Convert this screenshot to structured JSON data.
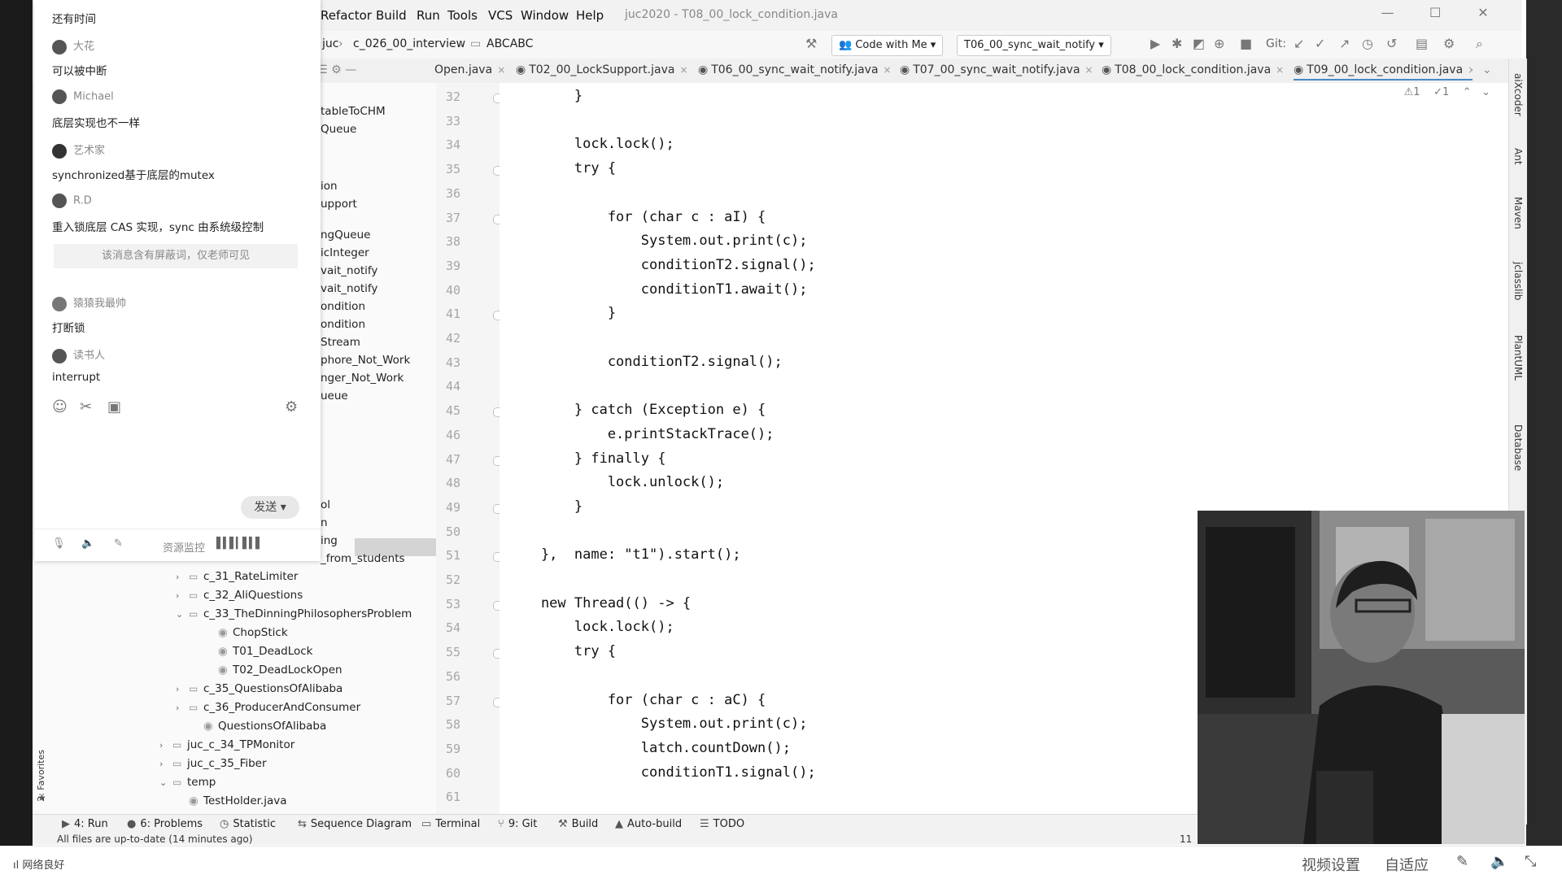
{
  "ide": {
    "menu": [
      "Refactor",
      "Build",
      "Run",
      "Tools",
      "VCS",
      "Window",
      "Help"
    ],
    "title": "juc2020 - T08_00_lock_condition.java",
    "breadcrumb": [
      "juc",
      "c_026_00_interview",
      "ABCABC"
    ],
    "toolbar": {
      "code_with_me": "Code with Me",
      "run_config": "T06_00_sync_wait_notify",
      "git_label": "Git:"
    },
    "tabs": [
      "Open.java",
      "T02_00_LockSupport.java",
      "T06_00_sync_wait_notify.java",
      "T07_00_sync_wait_notify.java",
      "T08_00_lock_condition.java",
      "T09_00_lock_condition.java"
    ],
    "inspection": {
      "warnings": "1",
      "weak_warnings": "1"
    }
  },
  "project_tree": {
    "partial_items": [
      "tableToCHM",
      "Queue",
      "ion",
      "upport",
      "ngQueue",
      "icInteger",
      "vait_notify",
      "vait_notify",
      "ondition",
      "ondition",
      "Stream",
      "phore_Not_Work",
      "nger_Not_Work",
      "ueue",
      "ol",
      "n",
      "ing",
      "_from_students"
    ],
    "items": [
      {
        "label": "c_31_RateLimiter",
        "type": "folder",
        "expanded": false
      },
      {
        "label": "c_32_AliQuestions",
        "type": "folder",
        "expanded": false
      },
      {
        "label": "c_33_TheDinningPhilosophersProblem",
        "type": "folder",
        "expanded": true
      },
      {
        "label": "ChopStick",
        "type": "class"
      },
      {
        "label": "T01_DeadLock",
        "type": "class"
      },
      {
        "label": "T02_DeadLockOpen",
        "type": "class"
      },
      {
        "label": "c_35_QuestionsOfAlibaba",
        "type": "folder",
        "expanded": false
      },
      {
        "label": "c_36_ProducerAndConsumer",
        "type": "folder",
        "expanded": false
      },
      {
        "label": "QuestionsOfAlibaba",
        "type": "class"
      },
      {
        "label": "juc_c_34_TPMonitor",
        "type": "folder",
        "expanded": false
      },
      {
        "label": "juc_c_35_Fiber",
        "type": "folder",
        "expanded": false
      },
      {
        "label": "temp",
        "type": "folder",
        "expanded": true
      },
      {
        "label": "TestHolder.java",
        "type": "class"
      }
    ]
  },
  "editor": {
    "lines": [
      {
        "n": "32",
        "text": "        }"
      },
      {
        "n": "33",
        "text": ""
      },
      {
        "n": "34",
        "text": "        lock.lock();"
      },
      {
        "n": "35",
        "text": "        try {"
      },
      {
        "n": "36",
        "text": ""
      },
      {
        "n": "37",
        "text": "            for (char c : aI) {"
      },
      {
        "n": "38",
        "text": "                System.out.print(c);"
      },
      {
        "n": "39",
        "text": "                conditionT2.signal();"
      },
      {
        "n": "40",
        "text": "                conditionT1.await();"
      },
      {
        "n": "41",
        "text": "            }"
      },
      {
        "n": "42",
        "text": ""
      },
      {
        "n": "43",
        "text": "            conditionT2.signal();"
      },
      {
        "n": "44",
        "text": ""
      },
      {
        "n": "45",
        "text": "        } catch (Exception e) {"
      },
      {
        "n": "46",
        "text": "            e.printStackTrace();"
      },
      {
        "n": "47",
        "text": "        } finally {"
      },
      {
        "n": "48",
        "text": "            lock.unlock();"
      },
      {
        "n": "49",
        "text": "        }"
      },
      {
        "n": "50",
        "text": ""
      },
      {
        "n": "51",
        "text": "    },  name: \"t1\").start();"
      },
      {
        "n": "52",
        "text": ""
      },
      {
        "n": "53",
        "text": "    new Thread(() -> {"
      },
      {
        "n": "54",
        "text": "        lock.lock();"
      },
      {
        "n": "55",
        "text": "        try {"
      },
      {
        "n": "56",
        "text": ""
      },
      {
        "n": "57",
        "text": "            for (char c : aC) {"
      },
      {
        "n": "58",
        "text": "                System.out.print(c);"
      },
      {
        "n": "59",
        "text": "                latch.countDown();"
      },
      {
        "n": "60",
        "text": "                conditionT1.signal();"
      },
      {
        "n": "61",
        "text": ""
      }
    ]
  },
  "right_tools": [
    "aiXcoder",
    "Ant",
    "Maven",
    "jclasslib",
    "PlantUML",
    "Database"
  ],
  "bottom_tools": [
    "4: Run",
    "6: Problems",
    "Statistic",
    "Sequence Diagram",
    "Terminal",
    "9: Git",
    "Build",
    "Auto-build",
    "TODO"
  ],
  "status": {
    "message": "All files are up-to-date (14 minutes ago)",
    "line": "11"
  },
  "favorites_label": "2: Favorites",
  "chat": {
    "header_msg": "还有时间",
    "messages": [
      {
        "user": "大花",
        "text": "可以被中断"
      },
      {
        "user": "Michael",
        "text": "底层实现也不一样"
      },
      {
        "user": "艺术家",
        "text": "synchronized基于底层的mutex"
      },
      {
        "user": "R.D",
        "text": "重入锁底层 CAS 实现，sync 由系统级控制"
      },
      {
        "user": "猿猿我最帅",
        "text": "打断锁"
      },
      {
        "user": "读书人",
        "text": "interrupt"
      }
    ],
    "notice": "该消息含有屏蔽词，仅老师可见",
    "send_label": "发送",
    "resource_monitor": "资源监控"
  },
  "player": {
    "network": "网络良好",
    "video_settings": "视频设置",
    "adaptive": "自适应"
  }
}
